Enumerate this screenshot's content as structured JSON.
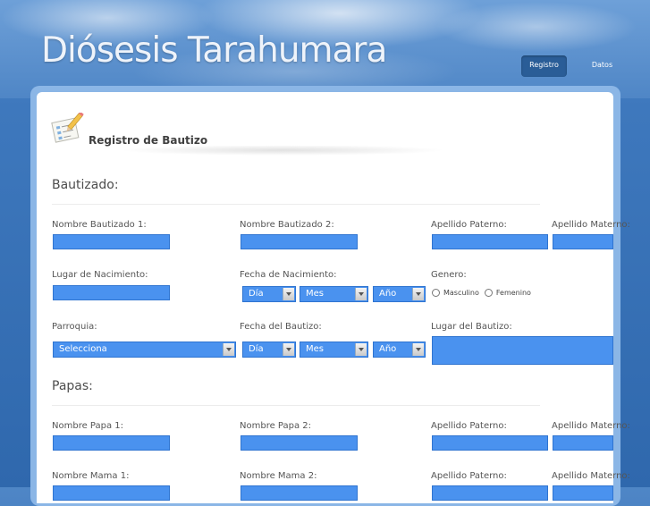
{
  "site": {
    "title": "Diósesis Tarahumara"
  },
  "nav": {
    "items": [
      {
        "label": "Registro",
        "active": true
      },
      {
        "label": "Datos",
        "active": false
      }
    ]
  },
  "page": {
    "title": "Registro de Bautizo",
    "icon": "form-edit-icon"
  },
  "sections": {
    "bautizado": {
      "title": "Bautizado:"
    },
    "papas": {
      "title": "Papas:"
    }
  },
  "bautizado": {
    "nombre1_label": "Nombre Bautizado 1:",
    "nombre2_label": "Nombre Bautizado 2:",
    "ap_paterno_label": "Apellido Paterno:",
    "ap_materno_label": "Apellido Materno:",
    "lugar_nacimiento_label": "Lugar de Nacimiento:",
    "fecha_nacimiento_label": "Fecha de Nacimiento:",
    "genero_label": "Genero:",
    "genero_options": [
      "Masculino",
      "Femenino"
    ],
    "parroquia_label": "Parroquia:",
    "parroquia_value": "Selecciona",
    "fecha_bautizo_label": "Fecha del Bautizo:",
    "lugar_bautizo_label": "Lugar del Bautizo:"
  },
  "date_select": {
    "day": "Día",
    "month": "Mes",
    "year": "Año"
  },
  "papas": {
    "papa1_label": "Nombre Papa 1:",
    "papa2_label": "Nombre Papa 2:",
    "papa_ap_paterno_label": "Apellido Paterno:",
    "papa_ap_materno_label": "Apellido Materno:",
    "mama1_label": "Nombre Mama 1:",
    "mama2_label": "Nombre Mama 2:",
    "mama_ap_paterno_label": "Apellido Paterno:",
    "mama_ap_materno_label": "Apellido Materno:"
  },
  "colors": {
    "field": "#4a92ef",
    "nav_active": "#2a5d97",
    "frame": "#8bb6e6"
  }
}
